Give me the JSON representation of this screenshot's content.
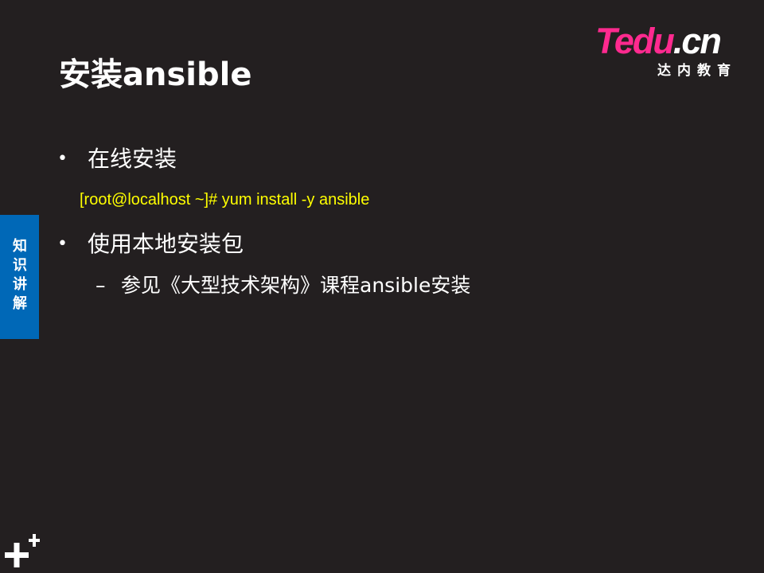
{
  "slide": {
    "title": "安装ansible",
    "logo": {
      "t": "T",
      "edu": "edu",
      "dot": ".",
      "cn": "cn",
      "subtitle": "达内教育"
    },
    "side_tab": {
      "label": "知识讲解"
    },
    "bullets": [
      {
        "text": "在线安装"
      },
      {
        "text": "使用本地安装包"
      }
    ],
    "code_line": "[root@localhost ~]# yum install -y ansible",
    "sub_bullet": "参见《大型技术架构》课程ansible安装",
    "bullet_symbol": "•",
    "dash_symbol": "–"
  },
  "colors": {
    "background": "#231f20",
    "code_text": "#ffff00",
    "side_tab": "#0068b7",
    "logo_accent": "#ff2a8f"
  },
  "icons": {
    "corner": "plus-icon"
  }
}
